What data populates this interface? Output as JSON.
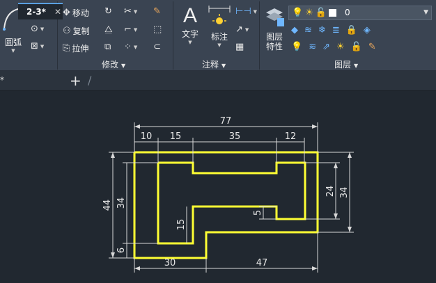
{
  "ribbon": {
    "draw": {
      "arc_label": "圆弧"
    },
    "modify": {
      "title": "修改",
      "move_label": "移动",
      "copy_label": "复制",
      "stretch_label": "拉伸"
    },
    "annotation": {
      "title": "注释",
      "text_label": "文字",
      "dimension_label": "标注"
    },
    "layers": {
      "title": "图层",
      "layer_props_line1": "图层",
      "layer_props_line2": "特性",
      "current_layer": "0"
    }
  },
  "tabs": {
    "active_tab": "2-3*",
    "close_glyph": "✕",
    "add_glyph": "+"
  },
  "drawing": {
    "dims_top": [
      "77",
      "10",
      "15",
      "35",
      "12"
    ],
    "dims_bottom": [
      "30",
      "47"
    ],
    "dims_left": [
      "44",
      "34",
      "6"
    ],
    "dims_right": [
      "24",
      "34"
    ],
    "dims_inner": [
      "15",
      "5"
    ]
  },
  "colors": {
    "ribbon_bg": "#3a4452",
    "canvas_bg": "#212830",
    "part_outline": "#ffff33",
    "dimension_line": "#d8d8d8"
  }
}
